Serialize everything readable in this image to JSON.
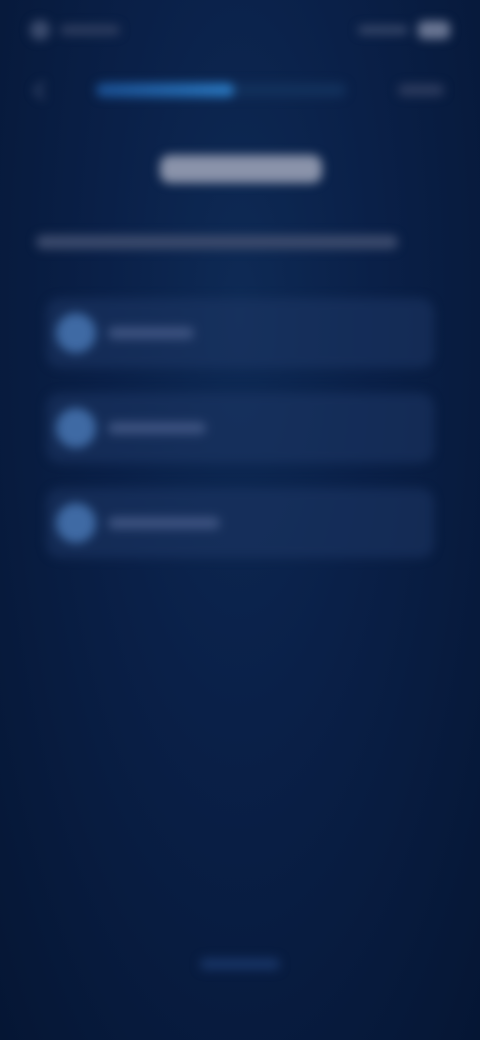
{
  "theme": {
    "background": "#07183a",
    "accent": "#2a78c0",
    "card": "#1e3764"
  },
  "status_bar": {
    "left_icon": "app-icon",
    "right_icon": "battery-icon"
  },
  "top_bar": {
    "back_icon": "back-chevron-icon",
    "progress_fraction": 0.55
  },
  "options": [
    {
      "icon": "circle-icon"
    },
    {
      "icon": "circle-icon"
    },
    {
      "icon": "circle-icon"
    }
  ]
}
